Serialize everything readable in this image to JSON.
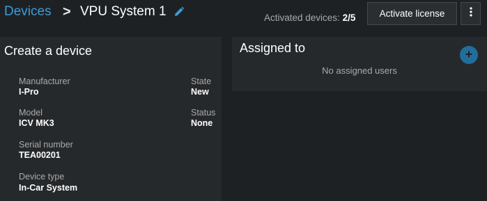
{
  "header": {
    "breadcrumb_root": "Devices",
    "separator": ">",
    "title": "VPU System 1",
    "activated_label": "Activated devices:",
    "activated_count": "2/5",
    "activate_button": "Activate license",
    "icons": {
      "edit": "pencil-icon",
      "more": "kebab-menu-icon"
    }
  },
  "create_device": {
    "title": "Create a device",
    "fields": [
      {
        "label": "Manufacturer",
        "value": "I-Pro"
      },
      {
        "label": "Model",
        "value": "ICV MK3"
      },
      {
        "label": "Serial number",
        "value": "TEA00201"
      },
      {
        "label": "Device type",
        "value": "In-Car System"
      }
    ],
    "side_fields": [
      {
        "label": "State",
        "value": "New"
      },
      {
        "label": "Status",
        "value": "None"
      }
    ]
  },
  "assigned": {
    "title": "Assigned to",
    "empty_message": "No assigned users",
    "add_icon": "plus-icon"
  },
  "colors": {
    "background": "#1e2124",
    "panel": "#26292c",
    "accent": "#3d9bd6",
    "add_button": "#216e9c"
  }
}
